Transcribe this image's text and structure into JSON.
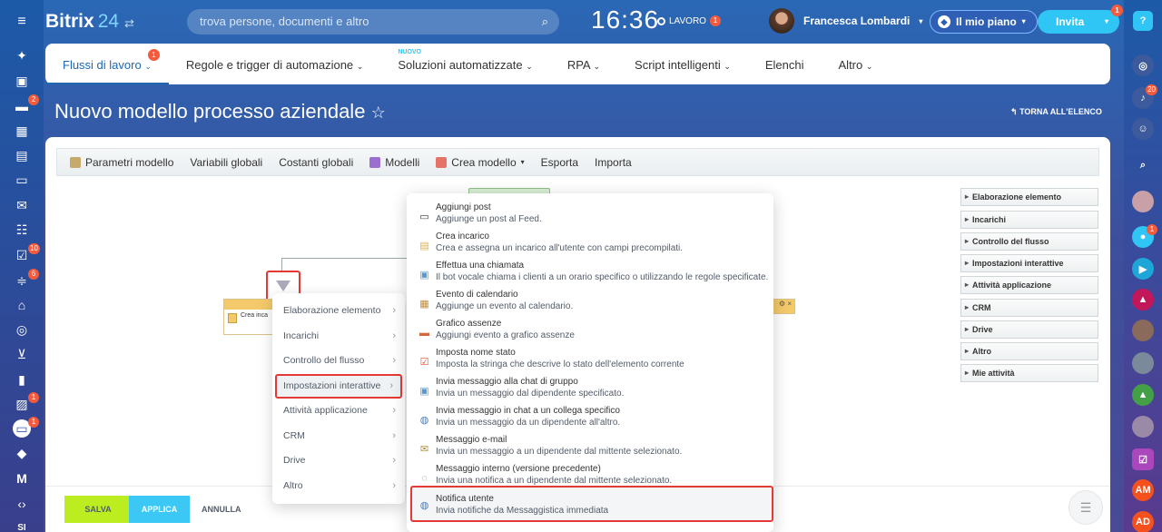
{
  "header": {
    "logo_name": "Bitrix",
    "logo_num": "24",
    "search_placeholder": "trova persone, documenti e altro",
    "clock": "16:36",
    "work_status": "LAVORO",
    "work_badge": "1",
    "user_name": "Francesca Lombardi",
    "plan_label": "Il mio piano",
    "invite_label": "Invita",
    "invite_badge": "1"
  },
  "leftbar": {
    "badges": [
      "2",
      "10",
      "6",
      "1",
      "1"
    ],
    "bottom_label": "SI"
  },
  "rightbar": {
    "notif_badge": "20",
    "chat_badge": "1",
    "initials": [
      "AM",
      "AD"
    ]
  },
  "topnav": [
    {
      "label": "Flussi di lavoro",
      "badge": "1"
    },
    {
      "label": "Regole e trigger di automazione"
    },
    {
      "label": "Soluzioni automatizzate",
      "tag": "NUOVO"
    },
    {
      "label": "RPA"
    },
    {
      "label": "Script intelligenti"
    },
    {
      "label": "Elenchi"
    },
    {
      "label": "Altro"
    }
  ],
  "page_title": "Nuovo modello processo aziendale",
  "back_link": "TORNA ALL'ELENCO",
  "toolbar": [
    "Parametri modello",
    "Variabili globali",
    "Costanti globali",
    "Modelli",
    "Crea modello",
    "Esporta",
    "Importa"
  ],
  "right_panels": [
    "Elaborazione elemento",
    "Incarichi",
    "Controllo del flusso",
    "Impostazioni interattive",
    "Attività applicazione",
    "CRM",
    "Drive",
    "Altro",
    "Mie attività"
  ],
  "canvas_block_text": "Crea inca",
  "submenu": [
    "Elaborazione elemento",
    "Incarichi",
    "Controllo del flusso",
    "Impostazioni interattive",
    "Attività applicazione",
    "CRM",
    "Drive",
    "Altro"
  ],
  "actions": [
    {
      "title": "Aggiungi post",
      "desc": "Aggiunge un post al Feed."
    },
    {
      "title": "Crea incarico",
      "desc": "Crea e assegna un incarico all'utente con campi precompilati."
    },
    {
      "title": "Effettua una chiamata",
      "desc": "Il bot vocale chiama i clienti a un orario specifico o utilizzando le regole specificate."
    },
    {
      "title": "Evento di calendario",
      "desc": "Aggiunge un evento al calendario."
    },
    {
      "title": "Grafico assenze",
      "desc": "Aggiungi evento a grafico assenze"
    },
    {
      "title": "Imposta nome stato",
      "desc": "Imposta la stringa che descrive lo stato dell'elemento corrente"
    },
    {
      "title": "Invia messaggio alla chat di gruppo",
      "desc": "Invia un messaggio dal dipendente specificato."
    },
    {
      "title": "Invia messaggio in chat a un collega specifico",
      "desc": "Invia un messaggio da un dipendente all'altro."
    },
    {
      "title": "Messaggio e-mail",
      "desc": "Invia un messaggio a un dipendente dal mittente selezionato."
    },
    {
      "title": "Messaggio interno (versione precedente)",
      "desc": "Invia una notifica a un dipendente dal mittente selezionato."
    },
    {
      "title": "Notifica utente",
      "desc": "Invia notifiche da Messaggistica immediata"
    }
  ],
  "bottom": {
    "save": "SALVA",
    "apply": "APPLICA",
    "cancel": "ANNULLA"
  },
  "colors": {
    "accent": "#2fc6f6",
    "save": "#bbed21",
    "highlight": "#e53935",
    "badge": "#f55a3c"
  }
}
